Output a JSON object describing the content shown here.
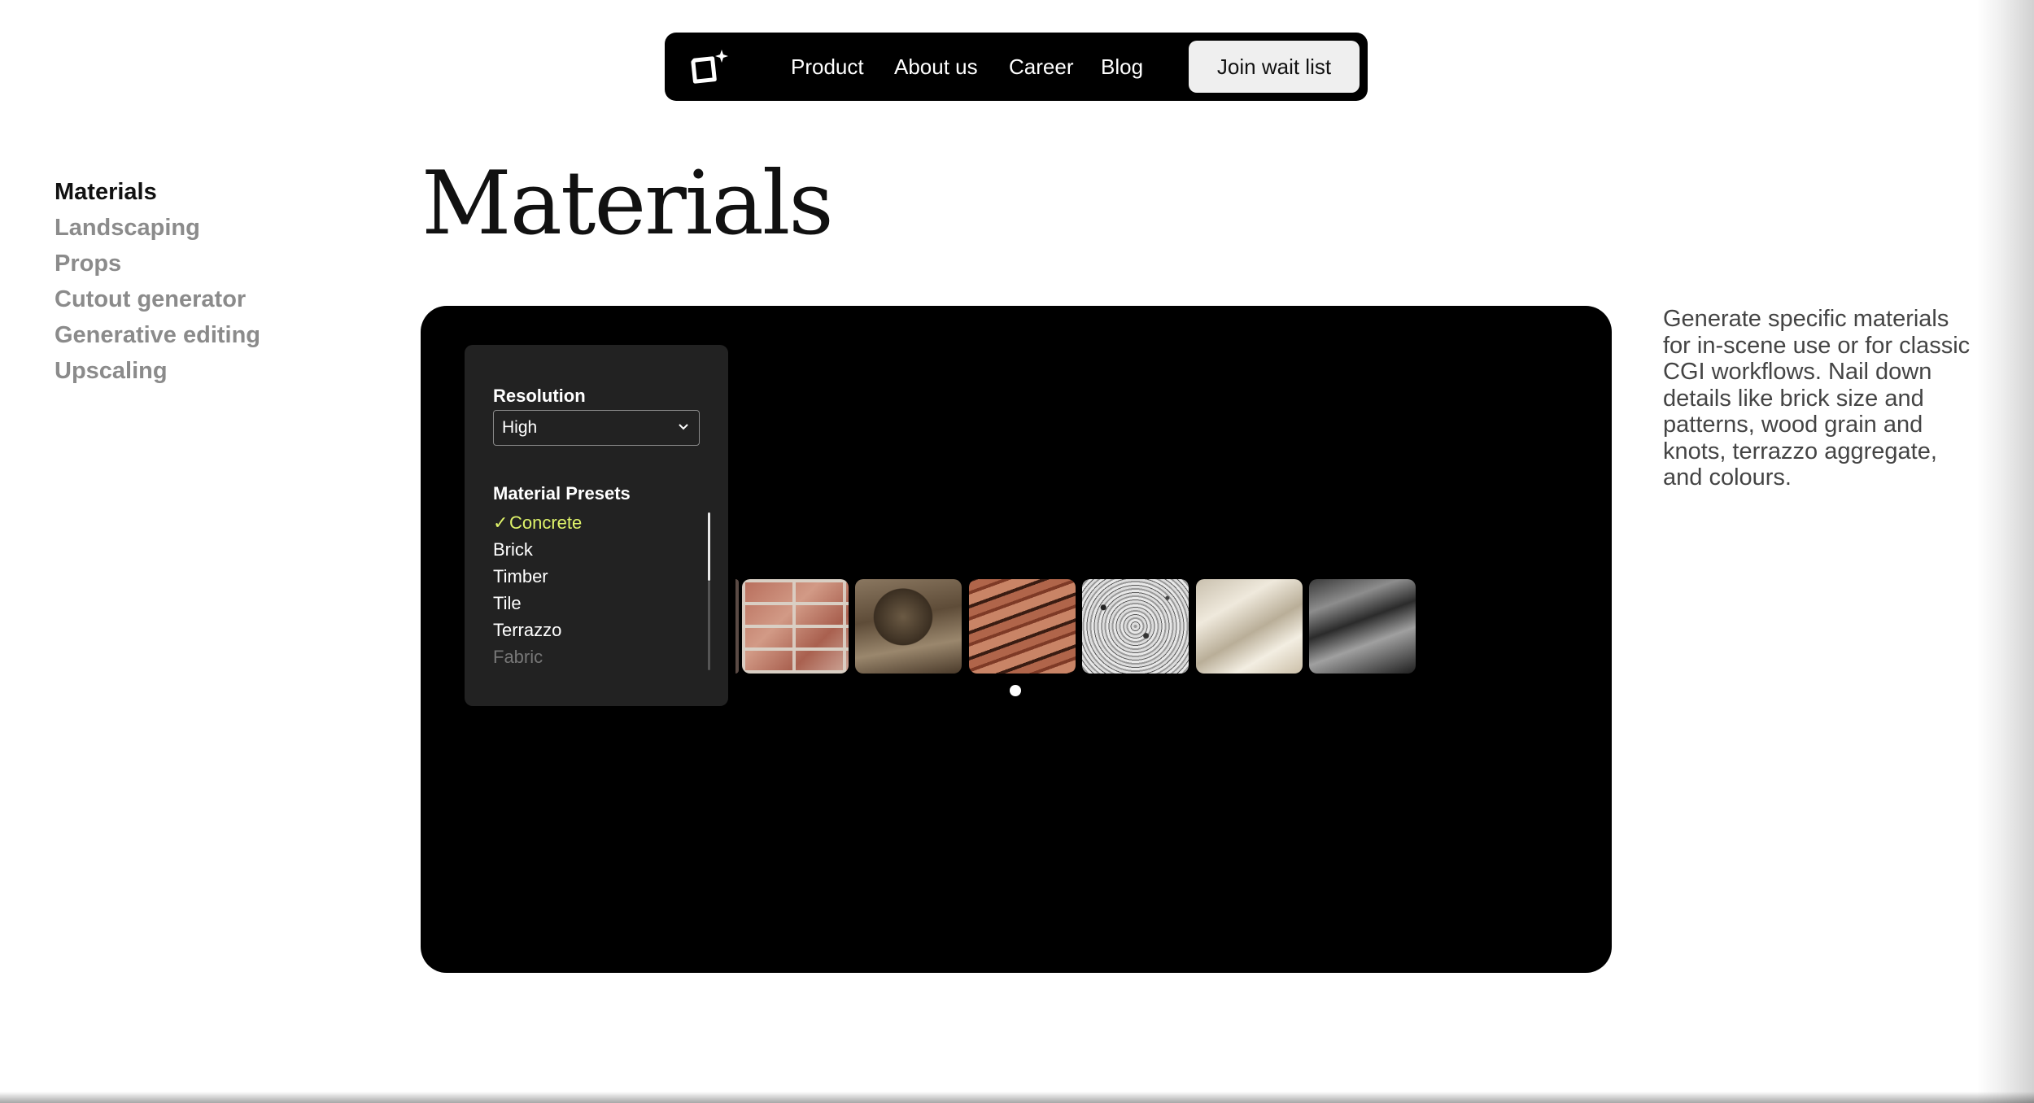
{
  "nav": {
    "logo_icon": "sparkle-square-logo",
    "links": [
      "Product",
      "About us",
      "Career",
      "Blog"
    ],
    "cta_label": "Join wait list"
  },
  "sidebar": {
    "items": [
      {
        "label": "Materials",
        "active": true
      },
      {
        "label": "Landscaping",
        "active": false
      },
      {
        "label": "Props",
        "active": false
      },
      {
        "label": "Cutout generator",
        "active": false
      },
      {
        "label": "Generative editing",
        "active": false
      },
      {
        "label": "Upscaling",
        "active": false
      }
    ]
  },
  "main": {
    "title": "Materials",
    "description": "Generate specific materials for in-scene use or for classic CGI workflows. Nail down details like brick size and patterns, wood grain and knots, terrazzo aggregate, and colours."
  },
  "panel": {
    "resolution_label": "Resolution",
    "resolution_value": "High",
    "presets_label": "Material Presets",
    "presets": [
      "Concrete",
      "Brick",
      "Timber",
      "Tile",
      "Terrazzo",
      "Fabric"
    ],
    "selected_preset": "Concrete",
    "accent_color": "#dff36a"
  },
  "gallery": {
    "thumbnails": [
      "brick",
      "timber",
      "wood-grain",
      "terrazzo",
      "fabric",
      "marble"
    ],
    "pagination_dots": 1
  }
}
